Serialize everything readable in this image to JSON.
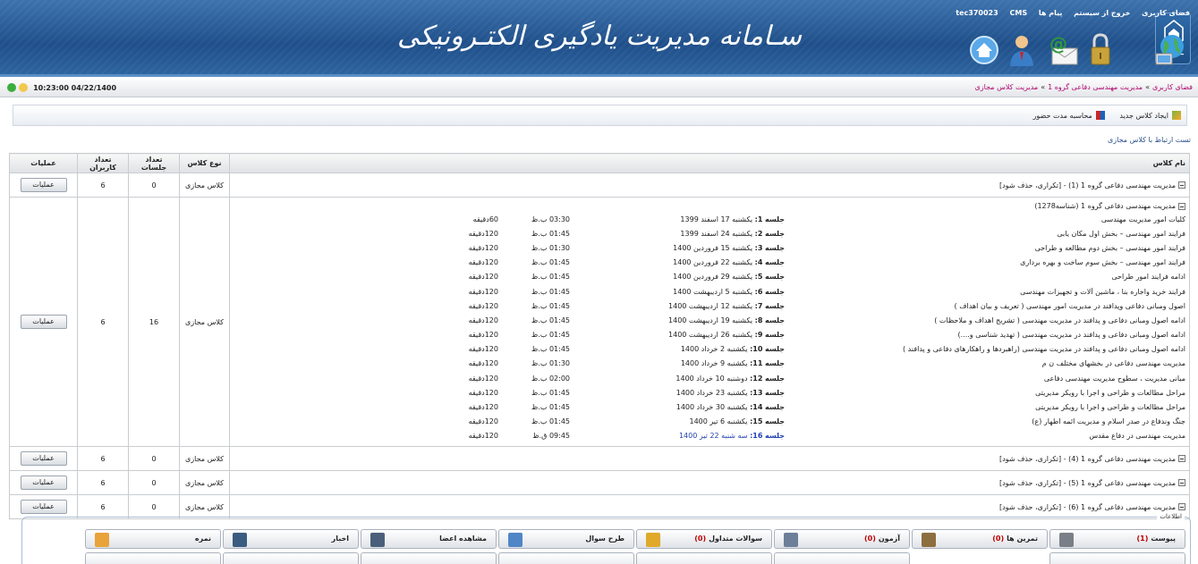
{
  "header": {
    "title": "سـامانه مدیریت یادگیری الکتـرونیکی",
    "top_menu": [
      "فضای کاربری",
      "خروج از سیستم",
      "پیام ها",
      "tec370023",
      "CMS"
    ],
    "icons": [
      "globe-icon",
      "lock-icon",
      "email-icon",
      "user-icon",
      "home-icon"
    ]
  },
  "breadcrumb": {
    "items": [
      "فضای کاربری",
      "مدیریت مهندسی دفاعی گروه 1",
      "مدیریت کلاس مجازی"
    ],
    "separator": "»"
  },
  "datetime": "10:23:00 04/22/1400",
  "toolbar": {
    "new_class": "ایجاد کلاس جدید",
    "attendance": "محاسبه مدت حضور"
  },
  "test_link": "تست ارتباط با کلاس مجازی",
  "table": {
    "headers": {
      "name": "نام کلاس",
      "type": "نوع کلاس",
      "sessions": "تعداد جلسات",
      "users": "تعداد کاربران",
      "ops": "عملیات"
    },
    "rows": [
      {
        "name": "مدیریت مهندسی دفاعی گروه 1 (1) - [تکراری، حذف شود]",
        "type": "کلاس مجازی",
        "sessions": "0",
        "users": "6",
        "ops": "عملیات"
      },
      {
        "name": "مدیریت مهندسی دفاعی گروه 1 (شناسه1278)",
        "type": "کلاس مجازی",
        "sessions": "16",
        "users": "6",
        "ops": "عملیات"
      },
      {
        "name": "مدیریت مهندسی دفاعی گروه 1 (4) - [تکراری، حذف شود]",
        "type": "کلاس مجازی",
        "sessions": "0",
        "users": "6",
        "ops": "عملیات"
      },
      {
        "name": "مدیریت مهندسی دفاعی گروه 1 (5) - [تکراری، حذف شود]",
        "type": "کلاس مجازی",
        "sessions": "0",
        "users": "6",
        "ops": "عملیات"
      },
      {
        "name": "مدیریت مهندسی دفاعی گروه 1 (6) - [تکراری، حذف شود]",
        "type": "کلاس مجازی",
        "sessions": "0",
        "users": "6",
        "ops": "عملیات"
      }
    ],
    "session_label": "جلسه",
    "sessions_detail": [
      {
        "n": "1:",
        "date": "یکشنبه 17 اسفند 1399",
        "time": "03:30 ب.ظ",
        "dur": "60دقیقه",
        "topic": "کلیات امور مدیریت مهندسی"
      },
      {
        "n": "2:",
        "date": "یکشنبه 24 اسفند 1399",
        "time": "01:45 ب.ظ",
        "dur": "120دقیقه",
        "topic": "فرایند امور مهندسی – بخش اول مکان یابی"
      },
      {
        "n": "3:",
        "date": "یکشنبه 15 فروردین 1400",
        "time": "01:30 ب.ظ",
        "dur": "120دقیقه",
        "topic": "فرایند امور مهندسی – بخش دوم مطالعه و طراحی"
      },
      {
        "n": "4:",
        "date": "یکشنبه 22 فروردین 1400",
        "time": "01:45 ب.ظ",
        "dur": "120دقیقه",
        "topic": "فرایند امور مهندسی – بخش سوم ساخت و بهره برداری"
      },
      {
        "n": "5:",
        "date": "یکشنبه 29 فروردین 1400",
        "time": "01:45 ب.ظ",
        "dur": "120دقیقه",
        "topic": "ادامه فرایند امور طراحی"
      },
      {
        "n": "6:",
        "date": "یکشنبه 5 اردیبهشت 1400",
        "time": "01:45 ب.ظ",
        "dur": "120دقیقه",
        "topic": "فرایند خرید واجاره بنا ، ماشین آلات و تجهیزات مهندسی"
      },
      {
        "n": "7:",
        "date": "یکشنبه 12 اردیبهشت 1400",
        "time": "01:45 ب.ظ",
        "dur": "120دقیقه",
        "topic": "اصول ومبانی دفاعی وپدافند در مدیریت امور مهندسی ( تعریف و بیان اهداف )"
      },
      {
        "n": "8:",
        "date": "یکشنبه 19 اردیبهشت 1400",
        "time": "01:45 ب.ظ",
        "dur": "120دقیقه",
        "topic": "ادامه اصول ومبانی دفاعی و پدافند در مدیریت مهندسی ( تشریح اهداف و ملاحظات )"
      },
      {
        "n": "9:",
        "date": "یکشنبه 26 اردیبهشت 1400",
        "time": "01:45 ب.ظ",
        "dur": "120دقیقه",
        "topic": "ادامه اصول ومبانی دفاعی و پدافند در مدیریت مهندسی ( تهدید شناسی و....)"
      },
      {
        "n": "10:",
        "date": "یکشنبه 2 خرداد 1400",
        "time": "01:45 ب.ظ",
        "dur": "120دقیقه",
        "topic": "ادامه اصول ومبانی دفاعی و پدافند در مدیریت مهندسی (راهبردها و راهکارهای دفاعی و پدافند )"
      },
      {
        "n": "11:",
        "date": "یکشنبه 9 خرداد 1400",
        "time": "01:30 ب.ظ",
        "dur": "120دقیقه",
        "topic": "مدیریت مهندسی دفاعی در بخشهای مختلف ن م"
      },
      {
        "n": "12:",
        "date": "دوشنبه 10 خرداد 1400",
        "time": "02:00 ب.ظ",
        "dur": "120دقیقه",
        "topic": "مبانی مدیریت ، سطوح مدیریت مهندسی دفاعی"
      },
      {
        "n": "13:",
        "date": "یکشنبه 23 خرداد 1400",
        "time": "01:45 ب.ظ",
        "dur": "120دقیقه",
        "topic": "مراحل مطالعات و طراحی و اجرا با رویکر مدیریتی"
      },
      {
        "n": "14:",
        "date": "یکشنبه 30 خرداد 1400",
        "time": "01:45 ب.ظ",
        "dur": "120دقیقه",
        "topic": "مراحل مطالعات و طراحی و اجرا با رویکر مدیریتی"
      },
      {
        "n": "15:",
        "date": "یکشنبه 6 تیر 1400",
        "time": "01:45 ب.ظ",
        "dur": "120دقیقه",
        "topic": "جنگ وندفاع در صدر اسلام و مدیریت ائمه اطهار (ع)"
      },
      {
        "n": "16:",
        "date": "سه شنبه 22 تیر 1400",
        "time": "09:45 ق.ظ",
        "dur": "120دقیقه",
        "topic": "مدیریت مهندسی در دفاع مقدس"
      }
    ]
  },
  "info_panel": {
    "legend": "اطلاعات",
    "row1": [
      {
        "label": "پیوست",
        "count": "(1)",
        "icon": "paperclip-icon"
      },
      {
        "label": "تمرین ها",
        "count": "(0)",
        "icon": "pencil-book-icon"
      },
      {
        "label": "آزمون",
        "count": "(0)",
        "icon": "exam-pen-icon"
      },
      {
        "label": "سوالات متداول",
        "count": "(0)",
        "icon": "faq-people-icon"
      },
      {
        "label": "طرح سوال",
        "count": "",
        "icon": "question-icon"
      },
      {
        "label": "مشاهده اعضا",
        "count": "",
        "icon": "members-icon"
      },
      {
        "label": "اخبار",
        "count": "",
        "icon": "megaphone-icon"
      },
      {
        "label": "نمره",
        "count": "",
        "icon": "grade-sheet-icon"
      }
    ]
  },
  "colors": {
    "header_blue": "#1f4f8a",
    "breadcrumb_magenta": "#b0086e",
    "count_red": "#c00000",
    "current_session_blue": "#1f3fb0"
  }
}
